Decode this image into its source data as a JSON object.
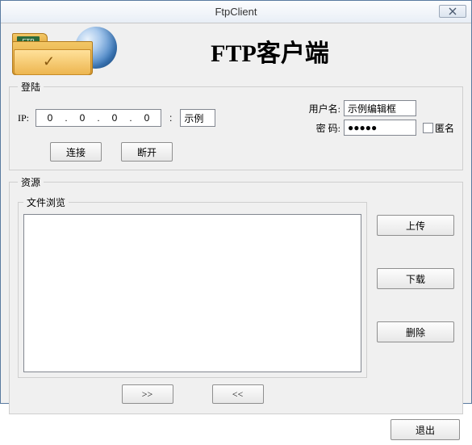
{
  "window": {
    "title": "FtpClient"
  },
  "header": {
    "app_title": "FTP客户端",
    "badge": "FTP"
  },
  "groups": {
    "login": "登陆",
    "resource": "资源",
    "files": "文件浏览"
  },
  "login": {
    "ip_label": "IP:",
    "ip": {
      "o1": "0",
      "o2": "0",
      "o3": "0",
      "o4": "0"
    },
    "dot": ".",
    "colon": ":",
    "port": "示例",
    "user_label": "用户名:",
    "user_value": "示例编辑框",
    "pass_label": "密  码:",
    "pass_value": "●●●●●",
    "anon_label": "匿名",
    "connect": "连接",
    "disconnect": "断开"
  },
  "resource": {
    "upload": "上传",
    "download": "下载",
    "delete": "删除",
    "next": ">>",
    "prev": "<<"
  },
  "footer": {
    "exit": "退出"
  }
}
